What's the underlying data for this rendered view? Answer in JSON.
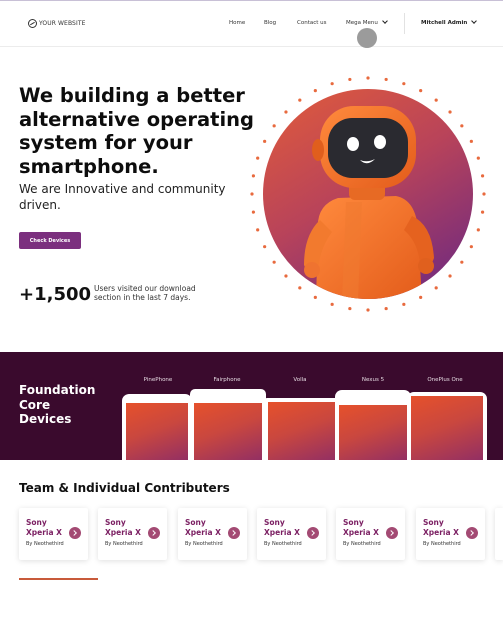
{
  "header": {
    "logo_text": "YOUR WEBSITE",
    "nav": [
      {
        "label": "Home"
      },
      {
        "label": "Blog"
      },
      {
        "label": "Contact us"
      },
      {
        "label": "Mega Menu"
      }
    ],
    "admin": "Mitchell Admin"
  },
  "hero": {
    "title": "We building a better alternative operating system for your smartphone.",
    "subtitle": "We are Innovative and community driven.",
    "button": "Check Devices",
    "stat_number": "+1,500",
    "stat_text": "Users visited our download section in the last 7 days."
  },
  "devices": {
    "title_lines": [
      "Foundation",
      "Core",
      "Devices"
    ],
    "items": [
      {
        "label": "PinePhone"
      },
      {
        "label": "Fairphone"
      },
      {
        "label": "Volla"
      },
      {
        "label": "Nexus 5"
      },
      {
        "label": "OnePlus One"
      }
    ]
  },
  "contributors": {
    "title": "Team & Individual Contributers",
    "cards": [
      {
        "name": "Sony Xperia X",
        "by": "By Neothethird"
      },
      {
        "name": "Sony Xperia X",
        "by": "By Neothethird"
      },
      {
        "name": "Sony Xperia X",
        "by": "By Neothethird"
      },
      {
        "name": "Sony Xperia X",
        "by": "By Neothethird"
      },
      {
        "name": "Sony Xperia X",
        "by": "By Neothethird"
      },
      {
        "name": "Sony Xperia X",
        "by": "By Neothethird"
      }
    ]
  },
  "colors": {
    "brand_purple": "#7b2f7e",
    "band_bg": "#3a0a2d",
    "card_title": "#7b1f62",
    "accent_orange": "#e6512b"
  }
}
